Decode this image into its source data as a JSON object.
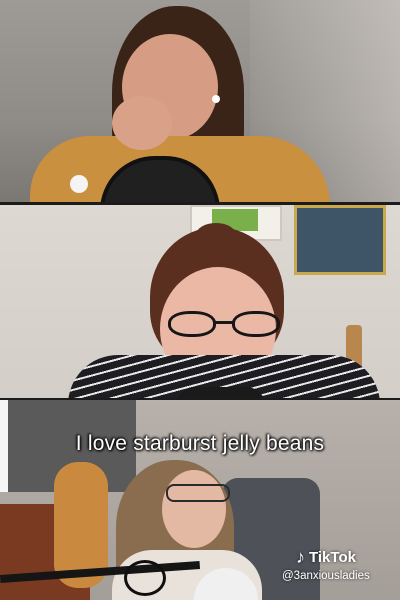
{
  "caption": "I love starburst jelly beans",
  "watermark": {
    "brand": "TikTok",
    "icon": "tiktok-note-icon",
    "handle": "@3anxiousladies"
  },
  "panels": [
    {
      "participant": "participant-1",
      "shirt_color": "#c9903f"
    },
    {
      "participant": "participant-2",
      "shirt_color": "#1d1d22"
    },
    {
      "participant": "participant-3",
      "shirt_color": "#e8e2da"
    }
  ]
}
